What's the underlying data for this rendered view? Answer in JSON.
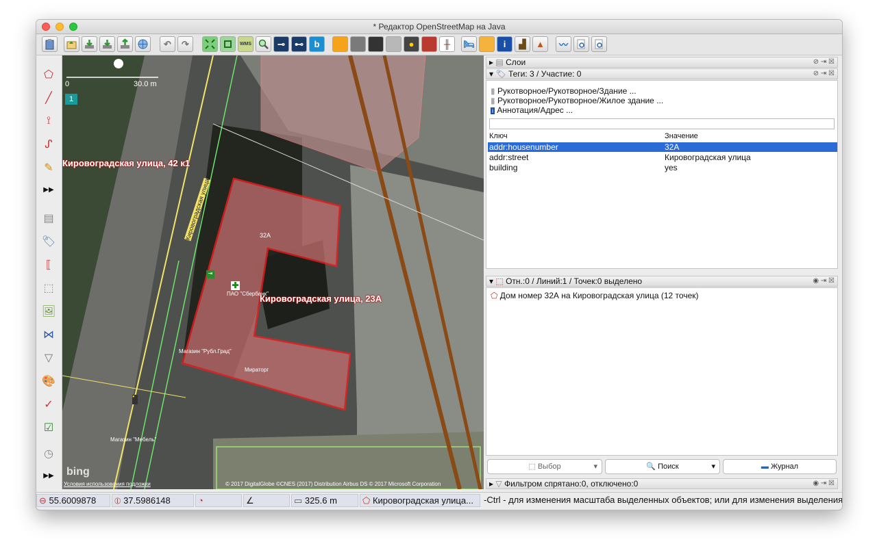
{
  "window": {
    "title": "* Редактор OpenStreetMap на Java"
  },
  "map": {
    "scale_label": "30.0 m",
    "scale_zero": "0",
    "layer_badge": "1",
    "bing_logo": "bing",
    "terms_link": "Условия использования подложки",
    "attribution": "© 2017 DigitalGlobe ©CNES (2017) Distribution Airbus DS © 2017 Microsoft Corporation",
    "labels": {
      "street_building_42": "Кировоградская улица, 42 к1",
      "street_vertical": "Кировоградская улица",
      "street_building_23a": "Кировоградская улица, 23А",
      "housenumber": "32А",
      "sberbank": "ПАО \"Сбербанк\"",
      "shop_grad": "Магазин \"Рубл.Град\"",
      "miratorg": "Мираторг",
      "shop_mebel": "Магазин \"Мебель\"",
      "entrance": "→⃞"
    }
  },
  "panels": {
    "layers": {
      "title": "Слои"
    },
    "tags": {
      "title": "Теги: 3 / Участие: 0",
      "presets": [
        "Рукотворное/Рукотворное/Здание ...",
        "Рукотворное/Рукотворное/Жилое здание ...",
        "Аннотация/Адрес ..."
      ],
      "filter_value": "",
      "columns": {
        "key": "Ключ",
        "value": "Значение"
      },
      "rows": [
        {
          "key": "addr:housenumber",
          "value": "32А"
        },
        {
          "key": "addr:street",
          "value": "Кировоградская улица"
        },
        {
          "key": "building",
          "value": "yes"
        }
      ]
    },
    "selection": {
      "title": "Отн.:0 / Линий:1 / Точек:0 выделено",
      "items": [
        "Дом номер 32А на Кировоградская улица (12 точек)"
      ],
      "buttons": {
        "select": "Выбор",
        "search": "Поиск",
        "history": "Журнал"
      }
    },
    "filter": {
      "title": "Фильтром спрятано:0, отключено:0"
    }
  },
  "status": {
    "lat": "55.6009878",
    "lon": "37.5986148",
    "heading": "",
    "angle": "",
    "distance": "325.6 m",
    "name": "Кировоградская улица...",
    "hint": "-Ctrl - для изменения масштаба выделенных объектов; или для изменения выделения"
  },
  "colors": {
    "selection_highlight": "#2a6bd6",
    "building_fill": "#e08b8b",
    "selected_way": "#ff1a1a",
    "road_brown": "#8a4a16"
  }
}
